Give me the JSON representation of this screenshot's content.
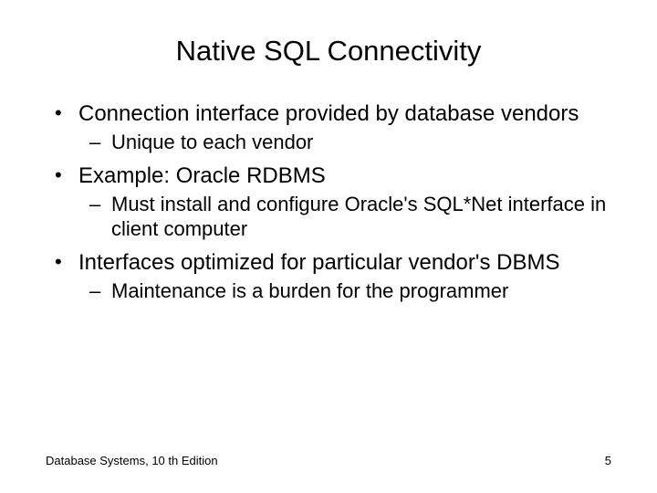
{
  "title": "Native SQL Connectivity",
  "bullets": [
    {
      "text": "Connection interface provided by database vendors",
      "sub": [
        "Unique to each vendor"
      ]
    },
    {
      "text": "Example: Oracle RDBMS",
      "sub": [
        "Must install and configure Oracle's SQL*Net interface in client computer"
      ]
    },
    {
      "text": "Interfaces optimized for particular vendor's DBMS",
      "sub": [
        "Maintenance is a burden for the programmer"
      ]
    }
  ],
  "footer": {
    "left": "Database Systems, 10 th Edition",
    "page": "5"
  }
}
